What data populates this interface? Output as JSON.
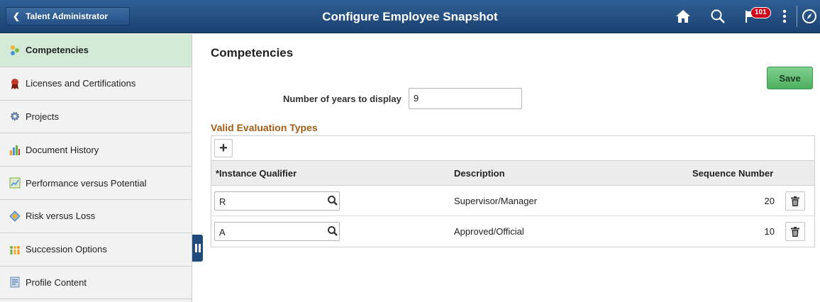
{
  "header": {
    "back_label": "Talent Administrator",
    "title": "Configure Employee Snapshot",
    "notification_count": "101",
    "icons": [
      "home-icon",
      "search-icon",
      "flag-icon",
      "kebab-icon",
      "navbar-icon"
    ]
  },
  "sidebar": {
    "items": [
      {
        "label": "Competencies",
        "icon": "competencies-icon",
        "active": true
      },
      {
        "label": "Licenses and Certifications",
        "icon": "ribbon-icon",
        "active": false
      },
      {
        "label": "Projects",
        "icon": "gear-icon",
        "active": false
      },
      {
        "label": "Document History",
        "icon": "bar-chart-icon",
        "active": false
      },
      {
        "label": "Performance versus Potential",
        "icon": "matrix-icon",
        "active": false
      },
      {
        "label": "Risk versus Loss",
        "icon": "diamond-icon",
        "active": false
      },
      {
        "label": "Succession Options",
        "icon": "people-icon",
        "active": false
      },
      {
        "label": "Profile Content",
        "icon": "document-icon",
        "active": false
      }
    ]
  },
  "main": {
    "section_title": "Competencies",
    "save_label": "Save",
    "years_label": "Number of years to display",
    "years_value": "9",
    "grid_title": "Valid Evaluation Types",
    "add_label": "+",
    "columns": [
      "*Instance Qualifier",
      "Description",
      "Sequence Number"
    ],
    "rows": [
      {
        "qualifier": "R",
        "description": "Supervisor/Manager",
        "sequence": "20"
      },
      {
        "qualifier": "A",
        "description": "Approved/Official",
        "sequence": "10"
      }
    ]
  },
  "colors": {
    "header_bg": "#1b4170",
    "active_item_bg": "#d2ead6",
    "save_green": "#4eaf61",
    "grid_title_brown": "#a15d16",
    "badge_red": "#d0021b"
  }
}
